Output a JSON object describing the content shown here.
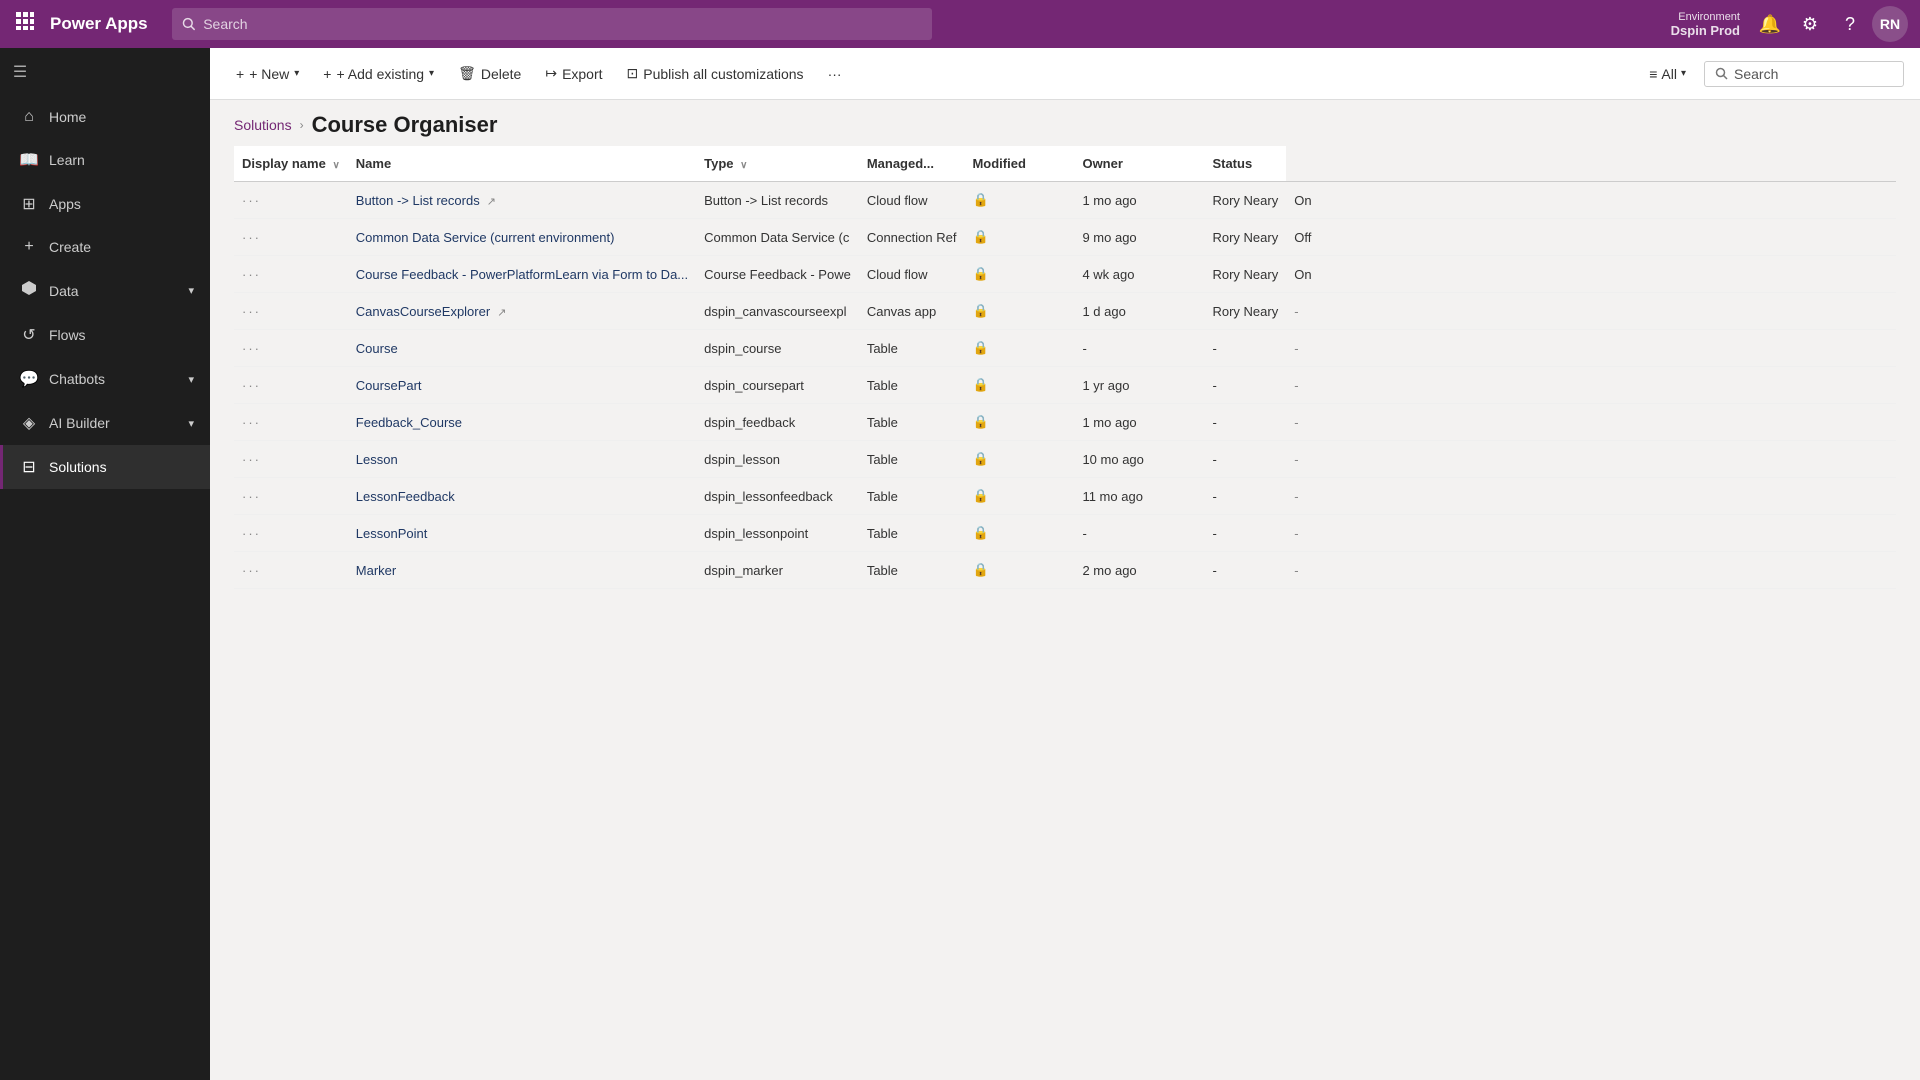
{
  "topNav": {
    "waffleIcon": "⊞",
    "logo": "Power Apps",
    "searchPlaceholder": "Search",
    "environment": {
      "label": "Environment",
      "name": "Dspin Prod"
    },
    "icons": {
      "bell": "🔔",
      "settings": "⚙",
      "help": "?"
    },
    "avatarInitials": "RN"
  },
  "sidebar": {
    "collapseIcon": "☰",
    "items": [
      {
        "id": "home",
        "icon": "⌂",
        "label": "Home",
        "active": false
      },
      {
        "id": "learn",
        "icon": "📖",
        "label": "Learn",
        "active": false
      },
      {
        "id": "apps",
        "icon": "⊞",
        "label": "Apps",
        "active": false
      },
      {
        "id": "create",
        "icon": "+",
        "label": "Create",
        "active": false
      },
      {
        "id": "data",
        "icon": "⬡",
        "label": "Data",
        "active": false,
        "hasChevron": true
      },
      {
        "id": "flows",
        "icon": "↺",
        "label": "Flows",
        "active": false
      },
      {
        "id": "chatbots",
        "icon": "💬",
        "label": "Chatbots",
        "active": false,
        "hasChevron": true
      },
      {
        "id": "aibuilder",
        "icon": "◈",
        "label": "AI Builder",
        "active": false,
        "hasChevron": true
      },
      {
        "id": "solutions",
        "icon": "⊟",
        "label": "Solutions",
        "active": true
      }
    ]
  },
  "toolbar": {
    "new_label": "+ New",
    "add_existing_label": "+ Add existing",
    "delete_label": "Delete",
    "export_label": "Export",
    "publish_all_label": "Publish all customizations",
    "more_label": "···",
    "all_label": "All",
    "search_label": "Search"
  },
  "breadcrumb": {
    "parent": "Solutions",
    "separator": "›",
    "current": "Course Organiser"
  },
  "table": {
    "columns": [
      {
        "id": "display_name",
        "label": "Display name",
        "sortable": true
      },
      {
        "id": "name",
        "label": "Name",
        "sortable": false
      },
      {
        "id": "type",
        "label": "Type",
        "sortable": true
      },
      {
        "id": "managed",
        "label": "Managed...",
        "sortable": false
      },
      {
        "id": "modified",
        "label": "Modified",
        "sortable": false
      },
      {
        "id": "owner",
        "label": "Owner",
        "sortable": false
      },
      {
        "id": "status",
        "label": "Status",
        "sortable": false
      }
    ],
    "rows": [
      {
        "display_name": "Button -> List records",
        "name": "Button -> List records",
        "type": "Cloud flow",
        "managed": true,
        "modified": "1 mo ago",
        "owner": "Rory Neary",
        "status": "On"
      },
      {
        "display_name": "Common Data Service (current environment)",
        "name": "Common Data Service (c",
        "type": "Connection Ref",
        "managed": true,
        "modified": "9 mo ago",
        "owner": "Rory Neary",
        "status": "Off"
      },
      {
        "display_name": "Course Feedback - PowerPlatformLearn via Form to Da...",
        "name": "Course Feedback - Powe",
        "type": "Cloud flow",
        "managed": true,
        "modified": "4 wk ago",
        "owner": "Rory Neary",
        "status": "On"
      },
      {
        "display_name": "CanvasCourseExplorer",
        "name": "dspin_canvascourseexpl",
        "type": "Canvas app",
        "managed": true,
        "modified": "1 d ago",
        "owner": "Rory Neary",
        "status": "-"
      },
      {
        "display_name": "Course",
        "name": "dspin_course",
        "type": "Table",
        "managed": true,
        "modified": "-",
        "owner": "-",
        "status": "-"
      },
      {
        "display_name": "CoursePart",
        "name": "dspin_coursepart",
        "type": "Table",
        "managed": true,
        "modified": "1 yr ago",
        "owner": "-",
        "status": "-"
      },
      {
        "display_name": "Feedback_Course",
        "name": "dspin_feedback",
        "type": "Table",
        "managed": true,
        "modified": "1 mo ago",
        "owner": "-",
        "status": "-"
      },
      {
        "display_name": "Lesson",
        "name": "dspin_lesson",
        "type": "Table",
        "managed": true,
        "modified": "10 mo ago",
        "owner": "-",
        "status": "-"
      },
      {
        "display_name": "LessonFeedback",
        "name": "dspin_lessonfeedback",
        "type": "Table",
        "managed": true,
        "modified": "11 mo ago",
        "owner": "-",
        "status": "-"
      },
      {
        "display_name": "LessonPoint",
        "name": "dspin_lessonpoint",
        "type": "Table",
        "managed": true,
        "modified": "-",
        "owner": "-",
        "status": "-"
      },
      {
        "display_name": "Marker",
        "name": "dspin_marker",
        "type": "Table",
        "managed": true,
        "modified": "2 mo ago",
        "owner": "-",
        "status": "-"
      }
    ]
  }
}
